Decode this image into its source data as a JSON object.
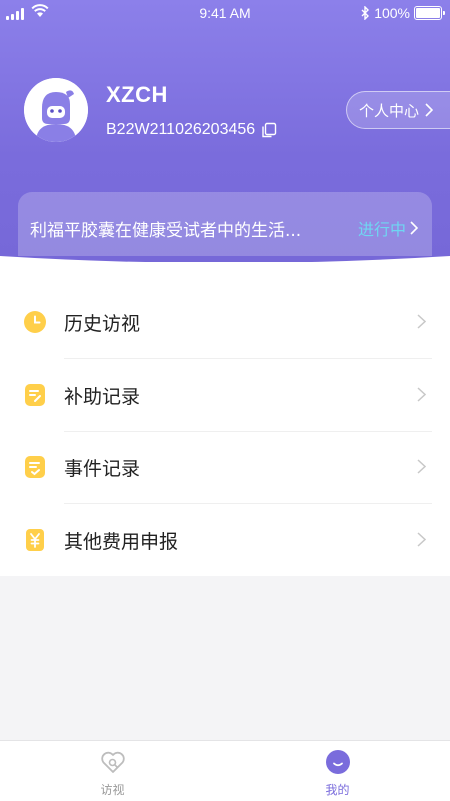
{
  "status_bar": {
    "time": "9:41 AM",
    "battery": "100%"
  },
  "profile": {
    "username": "XZCH",
    "user_id": "B22W211026203456",
    "personal_center_label": "个人中心"
  },
  "study": {
    "title": "利福平胶囊在健康受试者中的生活...",
    "status": "进行中"
  },
  "menu": [
    {
      "label": "历史访视",
      "icon": "clock-icon"
    },
    {
      "label": "补助记录",
      "icon": "note-icon"
    },
    {
      "label": "事件记录",
      "icon": "checklist-icon"
    },
    {
      "label": "其他费用申报",
      "icon": "yen-icon"
    }
  ],
  "tabbar": [
    {
      "label": "访视",
      "icon": "heart-search-icon",
      "active": false
    },
    {
      "label": "我的",
      "icon": "smile-icon",
      "active": true
    }
  ],
  "colors": {
    "accent": "#7a6cdc",
    "icon_yellow": "#ffcf4a",
    "status_cyan": "#6fd6f2",
    "tab_active": "#7a6cdc",
    "tab_inactive": "#999999"
  }
}
